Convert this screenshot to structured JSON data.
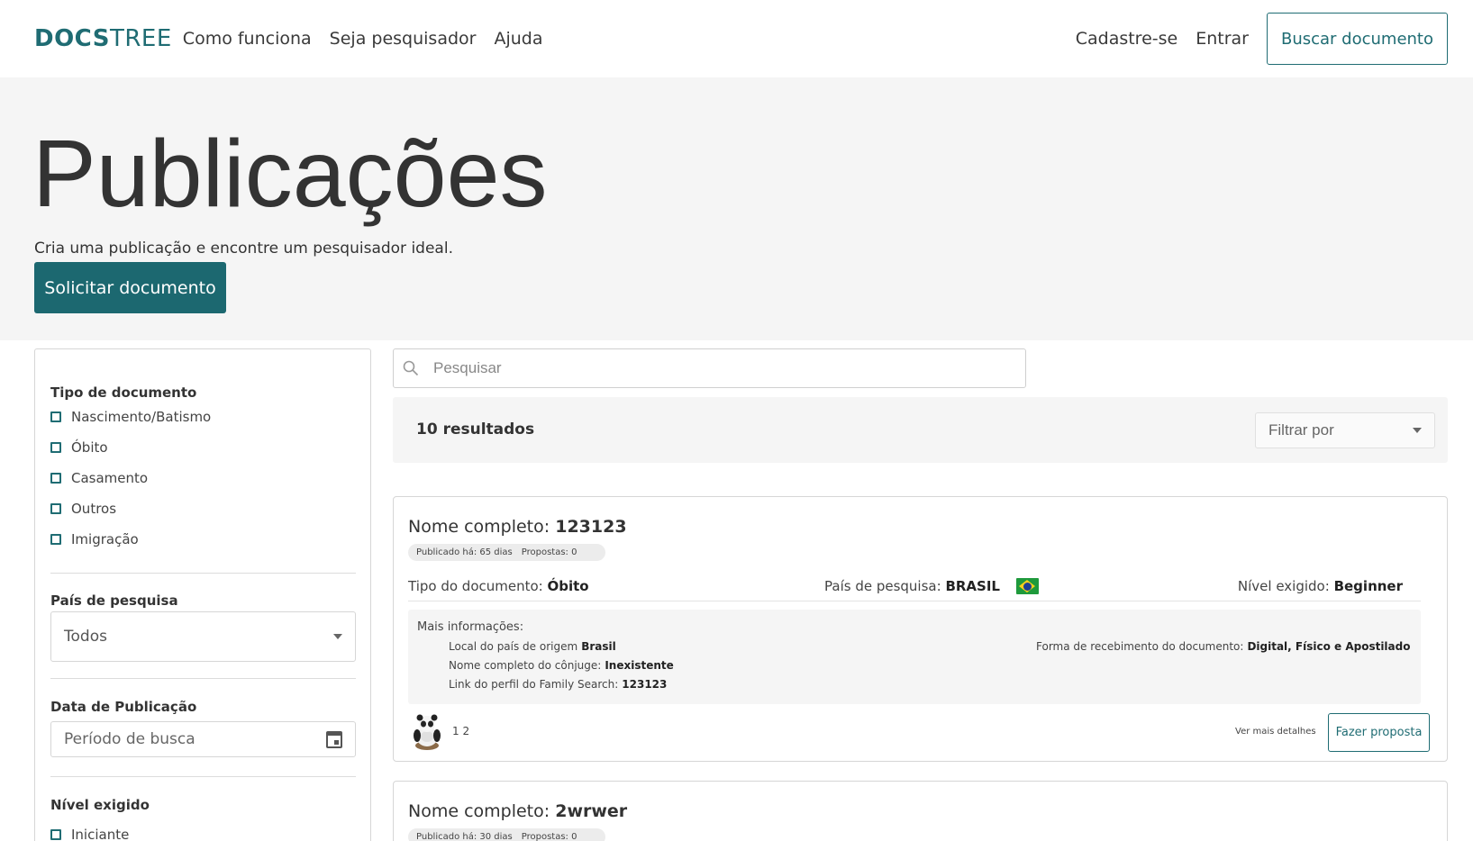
{
  "nav": {
    "logo_bold": "DOCS",
    "logo_light": "TREE",
    "links": [
      "Como funciona",
      "Seja pesquisador",
      "Ajuda"
    ],
    "signup": "Cadastre-se",
    "login": "Entrar",
    "search_doc": "Buscar documento"
  },
  "hero": {
    "title": "Publicações",
    "subtitle": "Cria uma publicação e encontre um pesquisador ideal.",
    "cta": "Solicitar documento"
  },
  "filters": {
    "doc_type_title": "Tipo de documento",
    "doc_types": [
      "Nascimento/Batismo",
      "Óbito",
      "Casamento",
      "Outros",
      "Imigração"
    ],
    "country_title": "País de pesquisa",
    "country_value": "Todos",
    "date_title": "Data de Publicação",
    "date_placeholder": "Período de busca",
    "level_title": "Nível exigido",
    "levels": [
      "Iniciante"
    ]
  },
  "search": {
    "placeholder": "Pesquisar"
  },
  "results": {
    "count": "10 resultados",
    "filter_placeholder": "Filtrar por"
  },
  "cards": [
    {
      "name_label": "Nome completo:",
      "name": "123123",
      "published": "Publicado há: 65 dias",
      "proposals": "Propostas: 0",
      "doc_type_label": "Tipo do documento:",
      "doc_type": "Óbito",
      "country_label": "País de pesquisa:",
      "country": "BRASIL",
      "level_label": "Nível exigido:",
      "level": "Beginner",
      "more_title": "Mais informações:",
      "origin_label": "Local do país de origem",
      "origin": "Brasil",
      "spouse_label": "Nome completo do cônjuge:",
      "spouse": "Inexistente",
      "fs_label": "Link do perfil do Family Search:",
      "fs": "123123",
      "receive_label": "Forma de recebimento do documento:",
      "receive": "Digital, Físico e Apostilado",
      "count": "1 2",
      "more_link": "Ver mais detalhes",
      "proposal_button": "Fazer proposta"
    },
    {
      "name_label": "Nome completo:",
      "name": "2wrwer",
      "published": "Publicado há: 30 dias",
      "proposals": "Propostas: 0"
    }
  ],
  "colors": {
    "brand": "#1c6870",
    "hero_bg": "#f5f5f5"
  }
}
